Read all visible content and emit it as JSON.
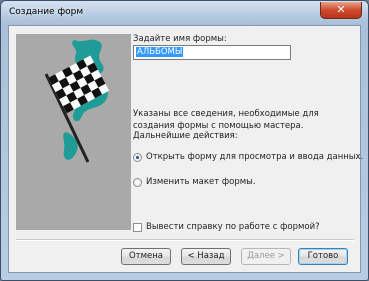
{
  "window": {
    "title": "Создание форм",
    "close_glyph": "✕"
  },
  "form": {
    "name_label": "Задайте имя формы:",
    "name_value": "АЛЬБОМЫ",
    "info_text": "Указаны все сведения, необходимые для создания формы с помощью мастера.",
    "next_actions_label": "Дальнейшие действия:",
    "options": [
      {
        "label": "Открыть форму для просмотра и ввода данных.",
        "selected": true
      },
      {
        "label": "Изменить макет формы.",
        "selected": false
      }
    ],
    "help_checkbox": {
      "label": "Вывести справку по работе с формой?",
      "checked": false
    }
  },
  "buttons": {
    "cancel": "Отмена",
    "back": "< Назад",
    "next": "Далее >",
    "finish": "Готово"
  },
  "icons": {
    "close": "close-icon",
    "art": "checkered-flag-icon"
  },
  "colors": {
    "accent": "#3399ff",
    "close_red": "#cf4a2c",
    "art_background": "#a9a9a9",
    "art_teal": "#1f9c97"
  }
}
